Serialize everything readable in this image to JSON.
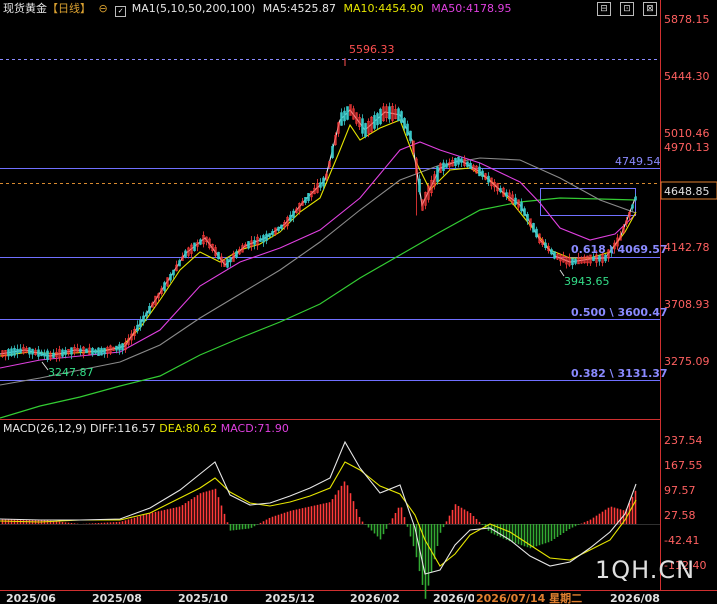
{
  "header": {
    "title": "现货黄金",
    "period_open": "【",
    "period": "日线",
    "period_close": "】",
    "ma_settings": "MA1(5,10,50,200,100)",
    "ma5": "MA5:4525.87",
    "ma10": "MA10:4454.90",
    "ma50": "MA50:4178.95",
    "window_buttons": [
      "⊟",
      "⊡",
      "⊠"
    ]
  },
  "colors": {
    "up": "#ff3b3b",
    "down": "#39c6c6",
    "ma5": "#e6e6e6",
    "ma10": "#e6e600",
    "ma50": "#e040e0",
    "ma100": "#8a8a8a",
    "ma200": "#33cc33",
    "fib": "#7070ff",
    "macd_pos": "#ff3b3b",
    "macd_neg": "#33aa33"
  },
  "price_axis": [
    "5878.15",
    "5444.30",
    "5010.46",
    "4970.13",
    "4749.54",
    "4648.85",
    "4142.78",
    "3708.93",
    "3275.09"
  ],
  "annotations": {
    "high": "5596.33",
    "low_2025": "3247.87",
    "low_recent": "3943.65",
    "fib_618": "0.618 \\ 4069.57",
    "fib_500": "0.500 \\ 3600.47",
    "fib_382": "0.382 \\ 3131.37"
  },
  "macd": {
    "title": "MACD(26,12,9)",
    "diff": "DIFF:116.57",
    "dea": "DEA:80.62",
    "macd": "MACD:71.90",
    "axis": [
      "237.54",
      "167.55",
      "97.57",
      "27.58",
      "-42.41",
      "-112.40"
    ]
  },
  "time_axis": [
    "2025/06",
    "2025/08",
    "2025/10",
    "2025/12",
    "2026/02",
    "2026/0",
    "2026/07/14 星期二",
    "2026/08"
  ],
  "watermark": "1QH.CN"
}
